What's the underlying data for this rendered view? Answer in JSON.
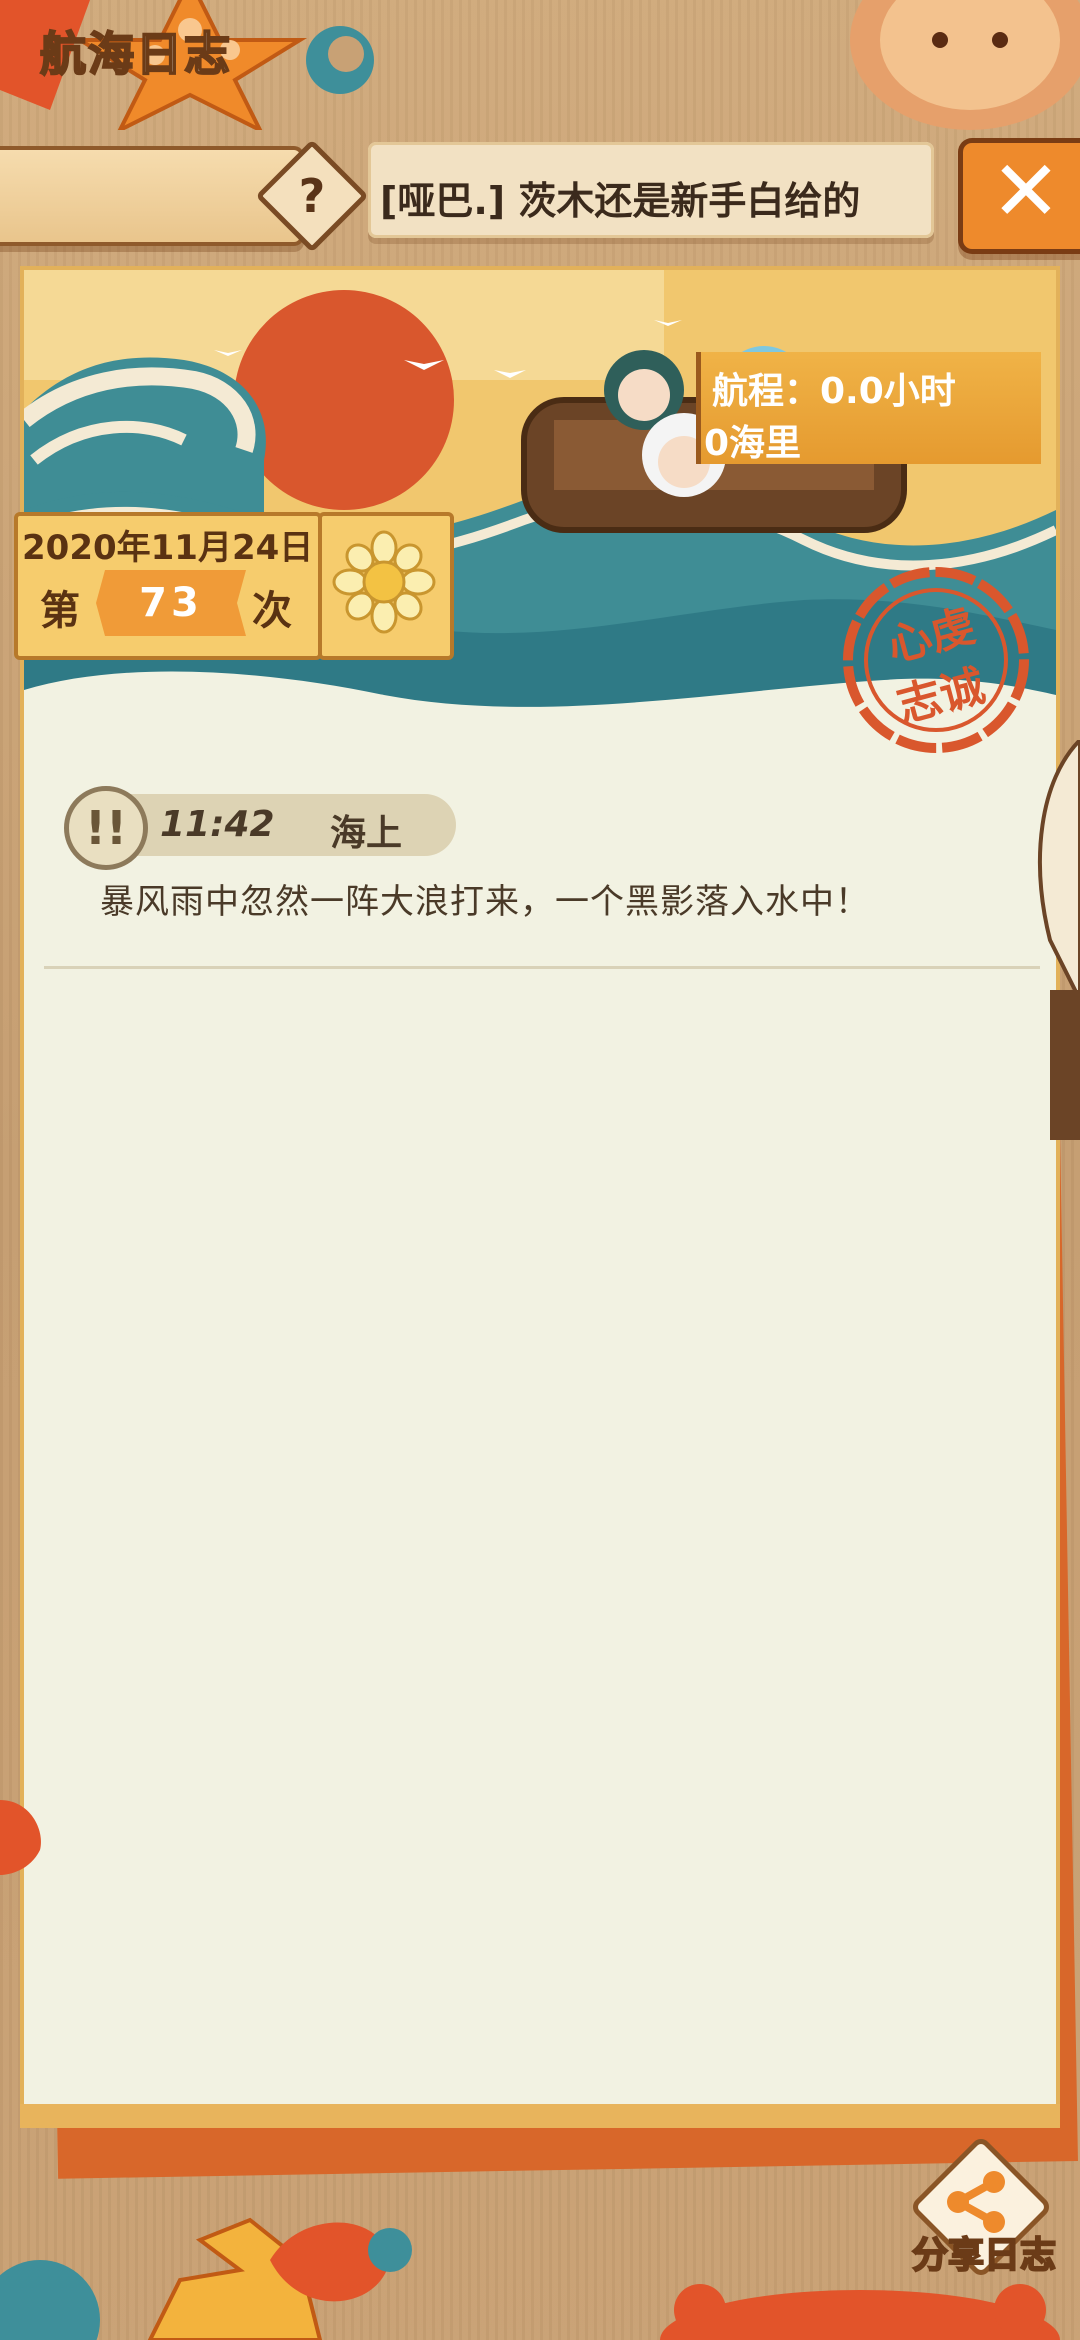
{
  "header": {
    "title": "航海日志",
    "help_icon": "question-icon",
    "ticker_text": "[哑巴.] 茨木还是新手白给的",
    "close_icon": "close-icon"
  },
  "voyage": {
    "duration": "航程：0.0小时",
    "distance": "0海里"
  },
  "date_card": {
    "date": "2020年11月24日",
    "count_label": "第",
    "count_value": "73",
    "count_unit": "次",
    "weather_icon": "sun-icon"
  },
  "stamp": {
    "text_top": "心虔",
    "text_bottom": "志诚"
  },
  "log_entries": [
    {
      "icon": "alert-icon",
      "time": "11:42",
      "place": "海上",
      "message": "暴风雨中忽然一阵大浪打来，一个黑影落入水中！"
    }
  ],
  "share": {
    "label": "分享日志",
    "icon": "share-icon"
  },
  "colors": {
    "accent_orange": "#ee8a2c",
    "paper": "#f2f2e2",
    "wood": "#c8a175",
    "stamp_red": "#d9572d"
  }
}
